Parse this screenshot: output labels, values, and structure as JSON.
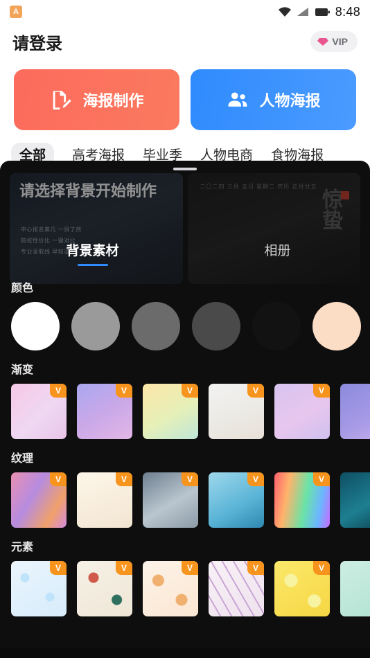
{
  "statusbar": {
    "badge_letter": "A",
    "time": "8:48",
    "icons": [
      "wifi-icon",
      "signal-icon",
      "battery-icon"
    ]
  },
  "header": {
    "title": "请登录",
    "vip": {
      "label": "VIP",
      "icon": "diamond-icon"
    }
  },
  "primary_actions": [
    {
      "label": "海报制作",
      "icon": "document-edit-icon",
      "color": "#fc6b5c"
    },
    {
      "label": "人物海报",
      "icon": "people-icon",
      "color": "#2f8bfd"
    }
  ],
  "category_tabs": [
    {
      "label": "全部",
      "active": true
    },
    {
      "label": "高考海报",
      "active": false
    },
    {
      "label": "毕业季",
      "active": false
    },
    {
      "label": "人物电商",
      "active": false
    },
    {
      "label": "食物海报",
      "active": false
    }
  ],
  "background_cards": {
    "card1_title": "请选择背景开始制作",
    "card1_lines": [
      "中心排名第几 一目了然",
      "院校性价比 一键对比",
      "专业录取线 早知道"
    ],
    "card2_calendar": "二〇二四 三月 五日 星期二 农历 正月廿五",
    "card2_big": "惊蛰"
  },
  "sheet": {
    "handle": "drag-handle",
    "tabs": [
      {
        "label": "背景素材",
        "active": true
      },
      {
        "label": "相册",
        "active": false
      }
    ],
    "sections": [
      {
        "title": "颜色",
        "type": "swatches",
        "items": [
          {
            "color": "#ffffff"
          },
          {
            "color": "#9a9a9a"
          },
          {
            "color": "#6b6b6b"
          },
          {
            "color": "#4a4a4a"
          },
          {
            "color": "#121212"
          },
          {
            "color": "#fbdcc4"
          },
          {
            "color": "#f7b98f"
          }
        ]
      },
      {
        "title": "渐变",
        "type": "thumbs",
        "badge": "V",
        "items": [
          {
            "css": "linear-gradient(135deg,#f6c8e6,#efd8f2 55%,#e9c4e8)"
          },
          {
            "css": "linear-gradient(150deg,#a9a7f0,#c9a8e8 50%,#e3b6e6)"
          },
          {
            "css": "linear-gradient(150deg,#fde6a8,#e6f0b8 55%,#bfe6d8)"
          },
          {
            "css": "linear-gradient(160deg,#f2f2f2,#ecebe6 50%,#e8e0d8)"
          },
          {
            "css": "linear-gradient(150deg,#d6c4ef,#e8c6ee 55%,#cfc0ee)"
          },
          {
            "css": "linear-gradient(150deg,#8b8bdd,#a89ae6 60%,#c9b4ef)"
          }
        ]
      },
      {
        "title": "纹理",
        "type": "thumbs",
        "badge": "V",
        "items": [
          {
            "css": "linear-gradient(120deg,#e98fb0,#b68ce0 40%,#f0a06a 75%,#d48be0)"
          },
          {
            "css": "linear-gradient(160deg,#fdf6e8,#f7ecdc 60%,#f2e4d0)"
          },
          {
            "css": "linear-gradient(150deg,#6f7f8f,#b9c6cf 55%,#8c9aa6)"
          },
          {
            "css": "linear-gradient(150deg,#9fd8ec,#58b3d6 60%,#2f87b0)"
          },
          {
            "css": "linear-gradient(100deg,#ff5f6d,#ffb36b 25%,#6be3a6 55%,#6bb6ff 80%,#c86bff)"
          },
          {
            "css": "linear-gradient(150deg,#0f4f63,#1d7f91 55%,#0b3a4a)"
          }
        ]
      },
      {
        "title": "元素",
        "type": "thumbs",
        "badge": "V",
        "items": [
          {
            "css": "linear-gradient(150deg,#eaf5fd,#d7ecfa)"
          },
          {
            "css": "linear-gradient(150deg,#f6f1e6,#efe6d6)"
          },
          {
            "css": "linear-gradient(150deg,#fdf3e8,#fbe6d2)"
          },
          {
            "css": "linear-gradient(150deg,#f8f1f6,#efe2ee)"
          },
          {
            "css": "linear-gradient(150deg,#fbe86a,#f6d744)"
          },
          {
            "css": "linear-gradient(150deg,#cdeee2,#b0e2d2)"
          }
        ]
      }
    ]
  }
}
